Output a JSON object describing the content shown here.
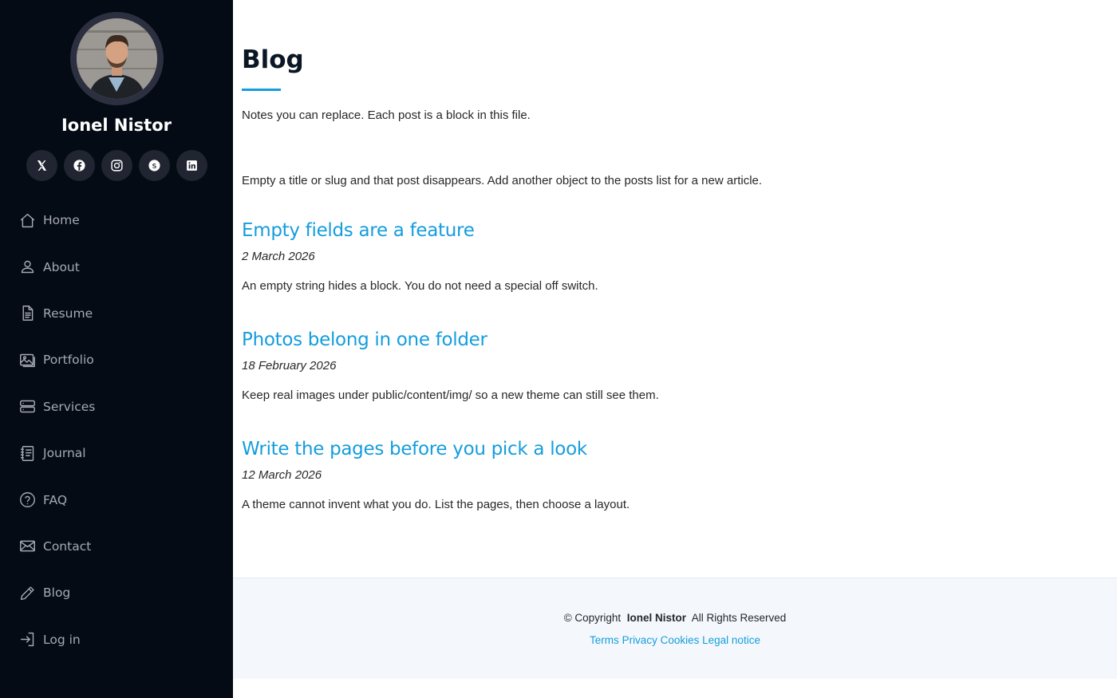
{
  "profile": {
    "name": "Ionel Nistor"
  },
  "socials": [
    {
      "name": "x",
      "icon": "x-icon"
    },
    {
      "name": "facebook",
      "icon": "facebook-icon"
    },
    {
      "name": "instagram",
      "icon": "instagram-icon"
    },
    {
      "name": "skype",
      "icon": "skype-icon"
    },
    {
      "name": "linkedin",
      "icon": "linkedin-icon"
    }
  ],
  "nav": {
    "items": [
      {
        "label": "Home",
        "icon": "home-icon"
      },
      {
        "label": "About",
        "icon": "user-icon"
      },
      {
        "label": "Resume",
        "icon": "file-icon"
      },
      {
        "label": "Portfolio",
        "icon": "images-icon"
      },
      {
        "label": "Services",
        "icon": "server-icon"
      },
      {
        "label": "Journal",
        "icon": "journal-icon"
      },
      {
        "label": "FAQ",
        "icon": "question-icon"
      },
      {
        "label": "Contact",
        "icon": "envelope-icon"
      },
      {
        "label": "Blog",
        "icon": "pencil-icon"
      },
      {
        "label": "Log in",
        "icon": "login-icon"
      }
    ]
  },
  "main": {
    "title": "Blog",
    "intro": "Notes you can replace. Each post is a block in this file.",
    "intro2": "Empty a title or slug and that post disappears. Add another object to the posts list for a new article.",
    "posts": [
      {
        "title": "Empty fields are a feature",
        "date": "2 March 2026",
        "excerpt": "An empty string hides a block. You do not need a special off switch."
      },
      {
        "title": "Photos belong in one folder",
        "date": "18 February 2026",
        "excerpt": "Keep real images under public/content/img/ so a new theme can still see them."
      },
      {
        "title": "Write the pages before you pick a look",
        "date": "12 March 2026",
        "excerpt": "A theme cannot invent what you do. List the pages, then choose a layout."
      }
    ]
  },
  "footer": {
    "copyright_prefix": "© Copyright",
    "copyright_name": "Ionel Nistor",
    "copyright_suffix": "All Rights Reserved",
    "links": [
      "Terms",
      "Privacy",
      "Cookies",
      "Legal notice"
    ]
  },
  "colors": {
    "sidebar_bg": "#040b14",
    "accent": "#149ddd",
    "footer_bg": "#f4f8fc"
  }
}
